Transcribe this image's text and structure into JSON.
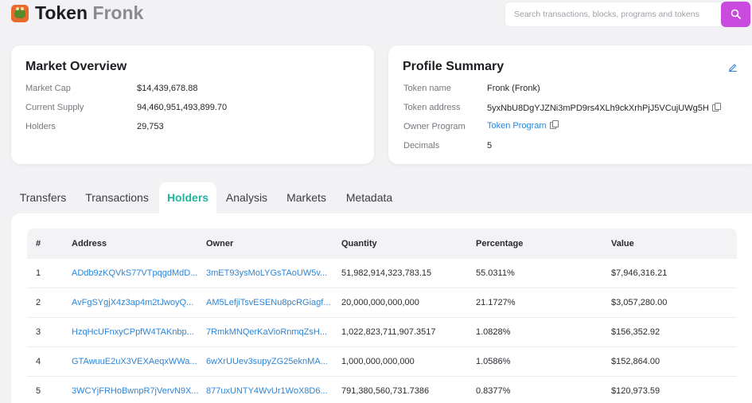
{
  "header": {
    "title_prefix": "Token",
    "title_name": "Fronk",
    "search_placeholder": "Search transactions, blocks, programs and tokens",
    "icons": {
      "logo": "fronk-frog-logo",
      "search": "search-icon"
    },
    "colors": {
      "accent": "#c84bde",
      "active_tab": "#1fb59a",
      "link": "#2c85d8"
    }
  },
  "market": {
    "title": "Market Overview",
    "rows": [
      {
        "label": "Market Cap",
        "value": "$14,439,678.88"
      },
      {
        "label": "Current Supply",
        "value": "94,460,951,493,899.70"
      },
      {
        "label": "Holders",
        "value": "29,753"
      }
    ]
  },
  "profile": {
    "title": "Profile Summary",
    "rows": [
      {
        "label": "Token name",
        "value": "Fronk (Fronk)"
      },
      {
        "label": "Token address",
        "value": "5yxNbU8DgYJZNi3mPD9rs4XLh9ckXrhPjJ5VCujUWg5H"
      },
      {
        "label": "Owner Program",
        "value": "Token Program"
      },
      {
        "label": "Decimals",
        "value": "5"
      }
    ]
  },
  "tabs": [
    {
      "label": "Transfers",
      "active": false
    },
    {
      "label": "Transactions",
      "active": false
    },
    {
      "label": "Holders",
      "active": true
    },
    {
      "label": "Analysis",
      "active": false
    },
    {
      "label": "Markets",
      "active": false
    },
    {
      "label": "Metadata",
      "active": false
    }
  ],
  "holders": {
    "columns": [
      "#",
      "Address",
      "Owner",
      "Quantity",
      "Percentage",
      "Value"
    ],
    "rows": [
      {
        "rank": "1",
        "address": "ADdb9zKQVkS77VTpqgdMdD...",
        "owner": "3mET93ysMoLYGsTAoUW5v...",
        "quantity": "51,982,914,323,783.15",
        "percentage": "55.0311%",
        "value": "$7,946,316.21"
      },
      {
        "rank": "2",
        "address": "AvFgSYgjX4z3ap4m2tJwoyQ...",
        "owner": "AM5LefjiTsvESENu8pcRGiagf...",
        "quantity": "20,000,000,000,000",
        "percentage": "21.1727%",
        "value": "$3,057,280.00"
      },
      {
        "rank": "3",
        "address": "HzqHcUFnxyCPpfW4TAKnbp...",
        "owner": "7RmkMNQerKaVioRnmqZsH...",
        "quantity": "1,022,823,711,907.3517",
        "percentage": "1.0828%",
        "value": "$156,352.92"
      },
      {
        "rank": "4",
        "address": "GTAwuuE2uX3VEXAeqxWWa...",
        "owner": "6wXrUUev3supyZG25eknMA...",
        "quantity": "1,000,000,000,000",
        "percentage": "1.0586%",
        "value": "$152,864.00"
      },
      {
        "rank": "5",
        "address": "3WCYjFRHoBwnpR7jVervN9X...",
        "owner": "877uxUNTY4WvUr1WoX8D6...",
        "quantity": "791,380,560,731.7386",
        "percentage": "0.8377%",
        "value": "$120,973.59"
      }
    ]
  }
}
